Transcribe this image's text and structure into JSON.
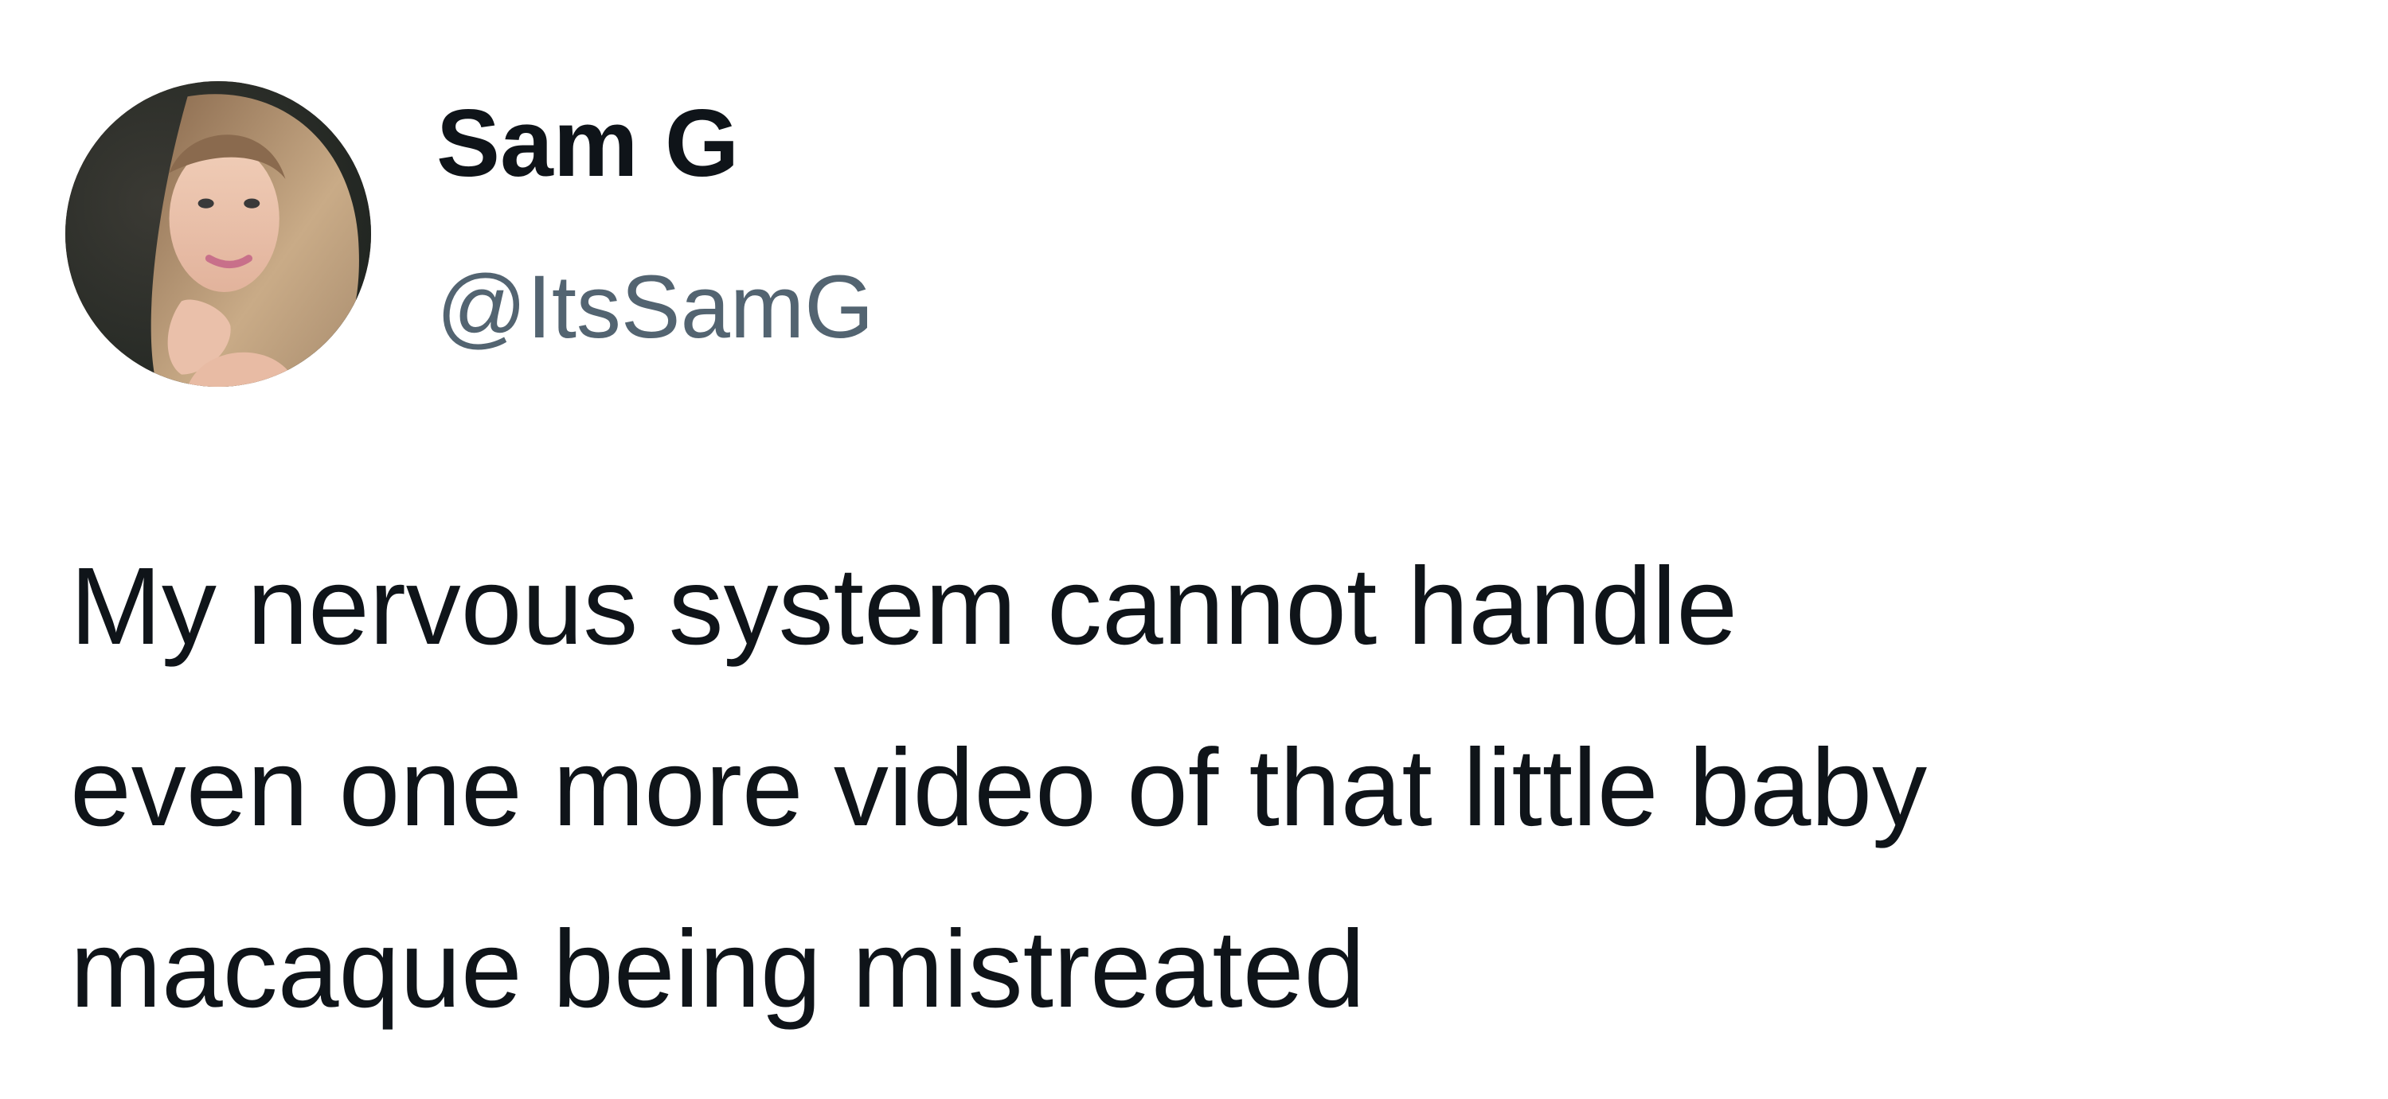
{
  "author": {
    "display_name": "Sam G",
    "handle": "@ItsSamG"
  },
  "tweet": {
    "lines": [
      "My nervous system cannot handle",
      "even one more video of that little baby",
      "macaque being mistreated"
    ]
  },
  "colors": {
    "text_primary": "#0f1419",
    "text_secondary": "#536471",
    "background": "#ffffff"
  }
}
